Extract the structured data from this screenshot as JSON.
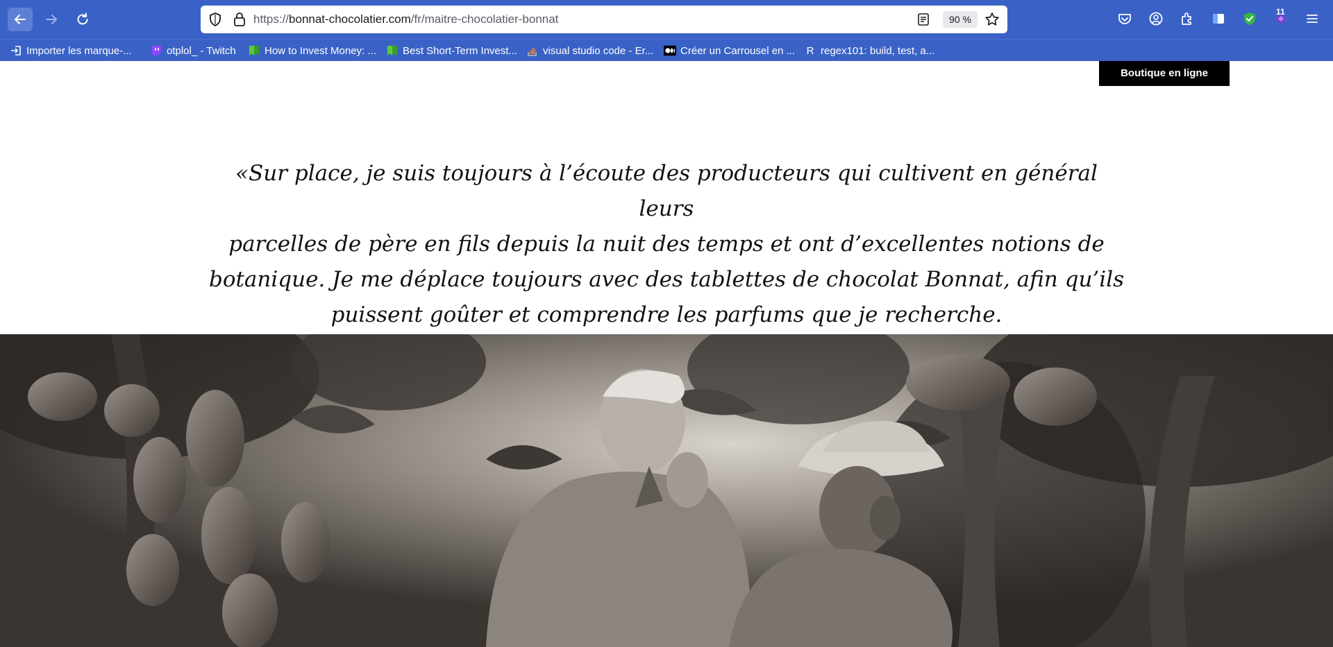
{
  "browser": {
    "url_prefix": "https://",
    "url_domain": "bonnat-chocolatier.com",
    "url_path": "/fr/maitre-chocolatier-bonnat",
    "zoom": "90 %",
    "notifications_badge": "11",
    "icons": [
      "back-arrow-icon",
      "forward-arrow-icon",
      "reload-icon",
      "shield-icon",
      "lock-icon",
      "reader-view-icon",
      "star-icon",
      "pocket-icon",
      "account-icon",
      "extensions-icon",
      "sidebar-icon",
      "adblock-shield-icon",
      "extension-diamond-icon",
      "menu-icon"
    ]
  },
  "bookmarks": [
    {
      "label": "Importer les marque-...",
      "icon": "import-icon"
    },
    {
      "label": "otplol_ - Twitch",
      "icon": "twitch-icon"
    },
    {
      "label": "How to Invest Money: ...",
      "icon": "bookmark-green-icon"
    },
    {
      "label": "Best Short-Term Invest...",
      "icon": "bookmark-green-icon"
    },
    {
      "label": "visual studio code - Er...",
      "icon": "stackoverflow-icon"
    },
    {
      "label": "Créer un Carrousel en ...",
      "icon": "medium-icon"
    },
    {
      "label": "regex101: build, test, a...",
      "icon": "regex-icon"
    }
  ],
  "page": {
    "shop_button": "Boutique en ligne",
    "quote_lines": [
      "«Sur place, je suis toujours à l’écoute des producteurs qui cultivent en général leurs",
      "parcelles de père en fils depuis la nuit des temps et ont d’excellentes notions de",
      "botanique. Je me déplace toujours avec des tablettes de chocolat Bonnat, afin qu’ils",
      "puissent goûter et comprendre les parfums que je recherche."
    ]
  }
}
